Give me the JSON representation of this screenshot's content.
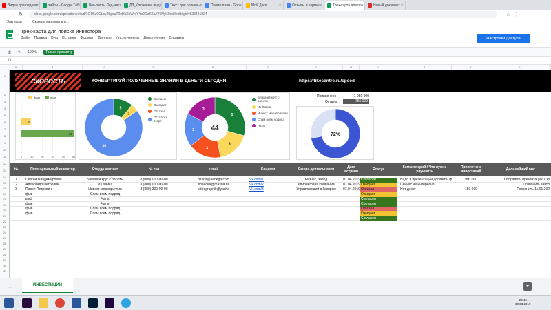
{
  "browser": {
    "tabs": [
      {
        "label": "Видео для лид-маг",
        "color": "#ff0000"
      },
      {
        "label": "хайпы - Google Таб",
        "color": "#0f9d58"
      },
      {
        "label": "Чек-листы Лид-маг",
        "color": "#0f9d58"
      },
      {
        "label": "ДЗ_Ключевые выд",
        "color": "#0f9d58"
      },
      {
        "label": "Текст для ролика -",
        "color": "#4285f4"
      },
      {
        "label": "Промо план - Goo",
        "color": "#4285f4"
      },
      {
        "label": "Мой Диск",
        "color": "#fbbc04"
      },
      {
        "label": "Отзывы и картин",
        "color": "#4285f4"
      },
      {
        "label": "Трек-карта для по",
        "color": "#0f9d58",
        "active": true
      },
      {
        "label": "Новый документ",
        "color": "#d93025"
      }
    ],
    "url": "docs.google.com/spreadsheets/d/1GD6z0CLsy48geu7ZoHkXbWnfYYx2DaK6aX76NyiOho8/edit#gid=823421824",
    "bookmarks": [
      "Закладки",
      "Скачать картинку в р..."
    ]
  },
  "doc": {
    "title": "Трек-карта для поиска инвестора",
    "menus": [
      "Файл",
      "Правка",
      "Вид",
      "Вставка",
      "Формат",
      "Данные",
      "Инструменты",
      "Дополнения",
      "Справка"
    ],
    "share_label": "Настройки Доступа",
    "zoom": "100%",
    "mode_badge": "Только просмотр",
    "formula_label": "fx"
  },
  "columns": [
    "A",
    "B",
    "C",
    "D",
    "E",
    "F",
    "G",
    "H",
    "I",
    "J",
    "K",
    "L"
  ],
  "rows": [
    "1",
    "2",
    "3",
    "4",
    "5",
    "6",
    "7",
    "8",
    "9",
    "10",
    "11",
    "12",
    "13",
    "14",
    "15",
    "16",
    "17",
    "18",
    "19",
    "20",
    "21",
    "22",
    "23",
    "24",
    "25",
    "26",
    "27",
    "28",
    "29",
    "30",
    "31",
    "32"
  ],
  "banner": {
    "logo": "СКОРОСТЬ",
    "title": "КОНВЕРТИРУЙ ПОЛУЧЕННЫЕ ЗНАНИЯ В ДЕНЬГИ СЕГОДНЯ",
    "url": "https://likecentre.ru/speed"
  },
  "chart_data": [
    {
      "type": "bar",
      "orientation": "horizontal",
      "series": [
        {
          "name": "факт",
          "color": "#f6d35e",
          "values": [
            9
          ]
        },
        {
          "name": "план",
          "color": "#6aa84f",
          "values": [
            52
          ]
        }
      ],
      "xticks": [
        "0",
        "10",
        "20",
        "30",
        "40",
        "50"
      ],
      "xlim": [
        0,
        50
      ],
      "legend": "top"
    },
    {
      "type": "pie",
      "donut": true,
      "slices": [
        {
          "name": "Согласен",
          "value": 5,
          "color": "#188038"
        },
        {
          "name": "Ожидает",
          "value": 2,
          "color": "#fbd75b"
        },
        {
          "name": "Отказал",
          "value": 0,
          "color": "#f4511e"
        },
        {
          "name": "Осталось встреч",
          "value": 39,
          "color": "#5b8def"
        }
      ],
      "labels_shown": [
        "5",
        "2",
        "39"
      ],
      "legend": "right"
    },
    {
      "type": "pie",
      "donut": true,
      "center_label": "44",
      "slices": [
        {
          "name": "Ближний круг с работы",
          "value": 5,
          "color": "#188038"
        },
        {
          "name": "Из Лайка",
          "value": 3,
          "color": "#fbd75b"
        },
        {
          "name": "Инвест мероприятия",
          "value": 3,
          "color": "#f4511e"
        },
        {
          "name": "Спам всем подряд",
          "value": 3,
          "color": "#5b8def"
        },
        {
          "name": "Чаты",
          "value": 3,
          "color": "#a61c96"
        }
      ],
      "labels_shown": [
        "5",
        "3",
        "3",
        "3"
      ],
      "legend": "right"
    },
    {
      "type": "pie",
      "donut": true,
      "center_label": "72%",
      "slices": [
        {
          "name": "Привлечено",
          "value": 72,
          "color": "#3c55d3"
        },
        {
          "name": "Остаток",
          "value": 28,
          "color": "#dbe1f5"
        }
      ],
      "legend": "none"
    }
  ],
  "summary": {
    "raised_label": "Привлечено",
    "raised_value": "1 050 000",
    "left_label": "Остаток",
    "left_value": "755 000"
  },
  "table": {
    "headers": [
      "№",
      "Потенциальный инвестор",
      "Откуда контакт",
      "№ тел",
      "e-mail",
      "Соцсети",
      "Сфера деятельности",
      "Дата встречи",
      "Статус",
      "Комментарий / Что нужно улучшить",
      "Привлечено инвестиций",
      "Дальнейший шаг"
    ],
    "rows": [
      {
        "n": "1",
        "name": "Сергей Владимирович",
        "source": "Ближний круг с работы",
        "phone": "8 (000) 000-00-00",
        "email": "dasda@senega.com",
        "social": "Vk.com/1",
        "sphere": "Бизнес, завод",
        "date": "07.04.2019",
        "status": "Согласен",
        "comment": "Надо в презентации добавить фин.модель",
        "raised": "900 000",
        "next": "Отправить презентацию с ф"
      },
      {
        "n": "2",
        "name": "Александр Петрович",
        "source": "Из Лайка",
        "phone": "8 (800) 000-00-00",
        "email": "sosedka@masha.ru",
        "social": "Vk.com/2",
        "sphere": "Клиринговая компания",
        "date": "07.04.2019",
        "status": "Ожидает",
        "comment": "Сейчас не интересно",
        "raised": "",
        "next": "Позвонить завтр"
      },
      {
        "n": "3",
        "name": "Павел Петрович",
        "source": "Инвест мероприятия",
        "phone": "8 (880) 300-00-00",
        "email": "odnogrupnik@yasha",
        "social": "Vk.com/3",
        "sphere": "Управляющий в Газпром",
        "date": "07.04.2019",
        "status": "Отказал",
        "comment": "Нет денег",
        "raised": "150 000",
        "next": "Позвонить 11.01.202"
      },
      {
        "n": "",
        "name": "фыв",
        "source": "Спам всем подряд",
        "phone": "",
        "email": "",
        "social": "",
        "sphere": "",
        "date": "",
        "status": "Ожидает",
        "comment": "",
        "raised": "",
        "next": ""
      },
      {
        "n": "",
        "name": "вмф",
        "source": "Чаты",
        "phone": "",
        "email": "",
        "social": "",
        "sphere": "",
        "date": "",
        "status": "Согласен",
        "comment": "",
        "raised": "",
        "next": ""
      },
      {
        "n": "",
        "name": "фыв",
        "source": "Чаты",
        "phone": "",
        "email": "",
        "social": "",
        "sphere": "",
        "date": "",
        "status": "Согласен",
        "comment": "",
        "raised": "",
        "next": ""
      },
      {
        "n": "",
        "name": "фыв",
        "source": "Спам всем подряд",
        "phone": "",
        "email": "",
        "social": "",
        "sphere": "",
        "date": "",
        "status": "Отказал",
        "comment": "",
        "raised": "",
        "next": ""
      },
      {
        "n": "",
        "name": "фыв",
        "source": "Спам всем подряд",
        "phone": "",
        "email": "",
        "social": "",
        "sphere": "",
        "date": "",
        "status": "Ожидает",
        "comment": "",
        "raised": "",
        "next": ""
      },
      {
        "n": "",
        "name": "",
        "source": "",
        "phone": "",
        "email": "",
        "social": "",
        "sphere": "",
        "date": "",
        "status": "Согласен",
        "comment": "",
        "raised": "",
        "next": ""
      }
    ]
  },
  "status_colors": {
    "Согласен": "#38761d",
    "Ожидает": "#f1c232",
    "Отказал": "#e06666"
  },
  "sheet_tab": "ИНВЕСТИЦИИ",
  "taskbar": {
    "time": "23:46",
    "date": "30.03.2019"
  }
}
